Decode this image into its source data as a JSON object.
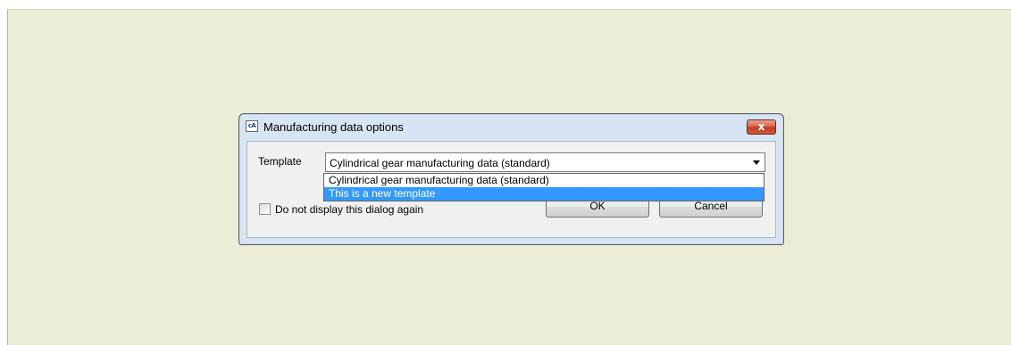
{
  "dialog": {
    "title": "Manufacturing data options",
    "app_icon_text": "cA",
    "close_label": "x"
  },
  "form": {
    "template_label": "Template",
    "template_value": "Cylindrical gear manufacturing data (standard)",
    "template_options": [
      "Cylindrical gear manufacturing data (standard)",
      "This is a new template"
    ],
    "selected_option_index": 1,
    "dont_display_label": "Do not display this dialog again",
    "dont_display_checked": false
  },
  "buttons": {
    "ok_label": "OK",
    "cancel_label": "Cancel"
  },
  "icons": {
    "app": "app-icon",
    "close": "close-icon",
    "dropdown": "chevron-down-icon"
  },
  "colors": {
    "background": "#ecedd7",
    "title_bar": "#d7e4f2",
    "close_button": "#c23a1f",
    "selection_highlight": "#3399ff"
  }
}
